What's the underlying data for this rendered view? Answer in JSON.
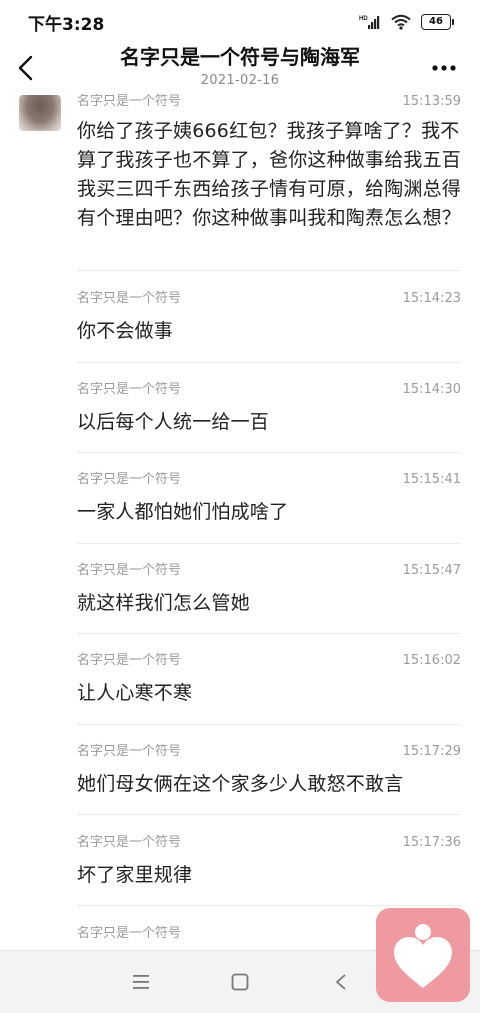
{
  "status_bar": {
    "time": "下午3:28",
    "battery": "46"
  },
  "header": {
    "title": "名字只是一个符号与陶海军",
    "date": "2021-02-16"
  },
  "messages": [
    {
      "sender": "名字只是一个符号",
      "time": "15:13:59",
      "text": "你给了孩子姨666红包？我孩子算啥了？我不算了我孩子也不算了，爸你这种做事给我五百我买三四千东西给孩子情有可原，给陶渊总得有个理由吧？你这种做事叫我和陶焘怎么想？"
    },
    {
      "sender": "名字只是一个符号",
      "time": "15:14:23",
      "text": "你不会做事"
    },
    {
      "sender": "名字只是一个符号",
      "time": "15:14:30",
      "text": "以后每个人统一给一百"
    },
    {
      "sender": "名字只是一个符号",
      "time": "15:15:41",
      "text": "一家人都怕她们怕成啥了"
    },
    {
      "sender": "名字只是一个符号",
      "time": "15:15:47",
      "text": "就这样我们怎么管她"
    },
    {
      "sender": "名字只是一个符号",
      "time": "15:16:02",
      "text": "让人心寒不寒"
    },
    {
      "sender": "名字只是一个符号",
      "time": "15:17:29",
      "text": "她们母女俩在这个家多少人敢怒不敢言"
    },
    {
      "sender": "名字只是一个符号",
      "time": "15:17:36",
      "text": "坏了家里规律"
    },
    {
      "sender": "名字只是一个符号",
      "time": "",
      "text": ""
    }
  ],
  "icons": {
    "back": "chevron-left-icon",
    "more": "more-dots-icon",
    "nav_menu": "menu-icon",
    "nav_home": "home-square-icon",
    "nav_back": "back-triangle-icon",
    "float_app": "heart-person-icon"
  },
  "colors": {
    "accent_pink": "#ef9aa0",
    "meta_gray": "#9a9a9a"
  }
}
